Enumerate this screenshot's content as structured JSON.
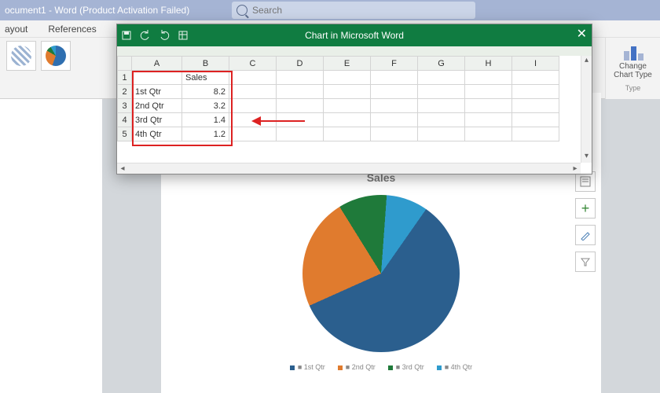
{
  "titlebar": {
    "text": "ocument1 - Word (Product Activation Failed)",
    "search_placeholder": "Search"
  },
  "ribbon_tabs": {
    "t1": "ayout",
    "t2": "References"
  },
  "ribbon_group": {
    "label_l1": "Change",
    "label_l2": "Chart Type",
    "group_name": "Type"
  },
  "excel": {
    "title": "Chart in Microsoft Word",
    "toolbar": {
      "save": "save-icon",
      "undo": "undo-icon",
      "redo": "redo-icon",
      "edit": "edit-data-icon"
    },
    "columns": [
      "A",
      "B",
      "C",
      "D",
      "E",
      "F",
      "G",
      "H",
      "I"
    ],
    "rows": [
      {
        "n": 1,
        "a": "",
        "b": "Sales"
      },
      {
        "n": 2,
        "a": "1st Qtr",
        "b": "8.2"
      },
      {
        "n": 3,
        "a": "2nd Qtr",
        "b": "3.2"
      },
      {
        "n": 4,
        "a": "3rd Qtr",
        "b": "1.4"
      },
      {
        "n": 5,
        "a": "4th Qtr",
        "b": "1.2"
      }
    ]
  },
  "chart_data": {
    "type": "pie",
    "title": "Sales",
    "categories": [
      "1st Qtr",
      "2nd Qtr",
      "3rd Qtr",
      "4th Qtr"
    ],
    "values": [
      8.2,
      3.2,
      1.4,
      1.2
    ],
    "colors": [
      "#2b5f8e",
      "#e07b2e",
      "#1f7a3a",
      "#2f9bcd"
    ],
    "legend_position": "bottom"
  },
  "chart_side_buttons": {
    "layout": "layout-options-icon",
    "add": "+",
    "brush": "brush-icon",
    "filter": "filter-icon"
  },
  "legend": {
    "i1": "1st Qtr",
    "i2": "2nd Qtr",
    "i3": "3rd Qtr",
    "i4": "4th Qtr"
  }
}
